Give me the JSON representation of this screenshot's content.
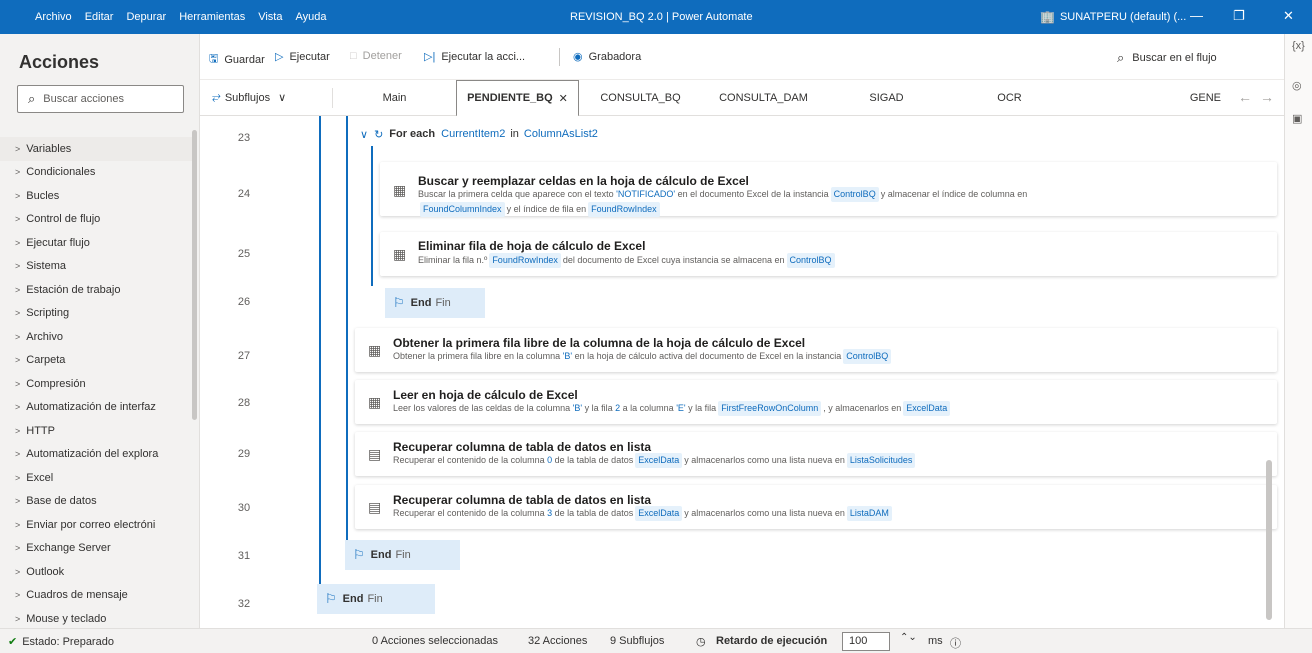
{
  "titlebar": {
    "menu": [
      "Archivo",
      "Editar",
      "Depurar",
      "Herramientas",
      "Vista",
      "Ayuda"
    ],
    "title": "REVISION_BQ 2.0 | Power Automate",
    "user": "SUNATPERU (default) (...",
    "minimize": "—",
    "restore": "❐",
    "close": "✕"
  },
  "left": {
    "heading": "Acciones",
    "search_placeholder": "Buscar acciones",
    "categories": [
      "Variables",
      "Condicionales",
      "Bucles",
      "Control de flujo",
      "Ejecutar flujo",
      "Sistema",
      "Estación de trabajo",
      "Scripting",
      "Archivo",
      "Carpeta",
      "Compresión",
      "Automatización de interfaz",
      "HTTP",
      "Automatización del explora",
      "Excel",
      "Base de datos",
      "Enviar por correo electróni",
      "Exchange Server",
      "Outlook",
      "Cuadros de mensaje",
      "Mouse y teclado"
    ]
  },
  "toolbar": {
    "save": "Guardar",
    "run": "Ejecutar",
    "stop": "Detener",
    "run_action": "Ejecutar la acci...",
    "recorder": "Grabadora",
    "flow_search": "Buscar en el flujo"
  },
  "right_strip": {
    "vars": "{x}"
  },
  "tabs": {
    "subflows": "Subflujos",
    "items": [
      "Main",
      "PENDIENTE_BQ",
      "CONSULTA_BQ",
      "CONSULTA_DAM",
      "SIGAD",
      "OCR",
      "GENE"
    ]
  },
  "flow": {
    "line_numbers": [
      "23",
      "24",
      "25",
      "26",
      "27",
      "28",
      "29",
      "30",
      "31",
      "32"
    ],
    "foreach": {
      "keyword": "For each",
      "var": "CurrentItem2",
      "in": "in",
      "list": "ColumnAsList2"
    },
    "end": {
      "keyword": "End",
      "label": "Fin"
    },
    "actions": {
      "a24": {
        "title": "Buscar y reemplazar celdas en la hoja de cálculo de Excel",
        "d1": "Buscar la primera celda que aparece con el texto",
        "d2": "'NOTIFICADO'",
        "d3": "en el documento Excel de la instancia",
        "t1": "ControlBQ",
        "d4": "y almacenar el índice de columna en",
        "t2": "FoundColumnIndex",
        "d5": "y el índice de fila en",
        "t3": "FoundRowIndex"
      },
      "a25": {
        "title": "Eliminar fila de hoja de cálculo de Excel",
        "d1": "Eliminar la fila n.º",
        "t1": "FoundRowIndex",
        "d2": "del documento de Excel cuya instancia se almacena en",
        "t2": "ControlBQ"
      },
      "a27": {
        "title": "Obtener la primera fila libre de la columna de la hoja de cálculo de Excel",
        "d1": "Obtener la primera fila libre en la columna",
        "d2": "'B'",
        "d3": "en la hoja de cálculo activa del documento de Excel en la instancia",
        "t1": "ControlBQ"
      },
      "a28": {
        "title": "Leer en hoja de cálculo de Excel",
        "d1": "Leer los valores de las celdas de la columna",
        "d2": "'B'",
        "d3": "y la fila",
        "d4": "2",
        "d5": "a la columna",
        "d6": "'E'",
        "d7": "y la fila",
        "t1": "FirstFreeRowOnColumn",
        "d8": ", y almacenarlos en",
        "t2": "ExcelData"
      },
      "a29": {
        "title": "Recuperar columna de tabla de datos en lista",
        "d1": "Recuperar el contenido de la columna",
        "d2": "0",
        "d3": "de la tabla de datos",
        "t1": "ExcelData",
        "d4": "y almacenarlos como una lista nueva en",
        "t2": "ListaSolicitudes"
      },
      "a30": {
        "title": "Recuperar columna de tabla de datos en lista",
        "d1": "Recuperar el contenido de la columna",
        "d2": "3",
        "d3": "de la tabla de datos",
        "t1": "ExcelData",
        "d4": "y almacenarlos como una lista nueva en",
        "t2": "ListaDAM"
      }
    }
  },
  "status": {
    "state": "Estado: Preparado",
    "selected": "0 Acciones seleccionadas",
    "actions": "32 Acciones",
    "subflows": "9 Subflujos",
    "delay_label": "Retardo de ejecución",
    "delay_value": "100",
    "unit": "ms"
  }
}
